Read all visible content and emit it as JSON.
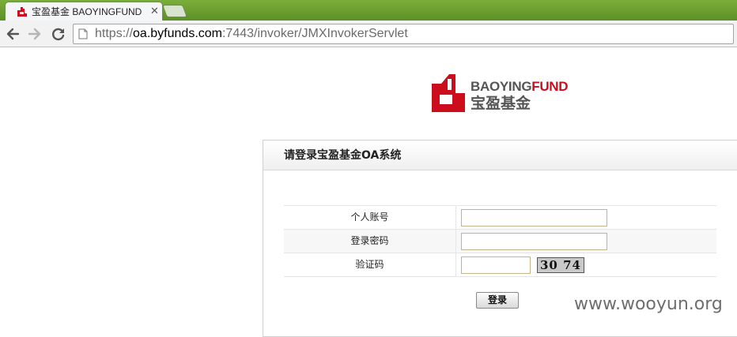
{
  "browser": {
    "tab": {
      "title": "宝盈基金 BAOYINGFUND",
      "close_glyph": "✕"
    },
    "address_bar": {
      "scheme": "https://",
      "host": "oa.byfunds.com",
      "rest": ":7443/invoker/JMXInvokerServlet"
    },
    "icons": {
      "back": "back-arrow-icon",
      "forward": "forward-arrow-icon",
      "reload": "reload-icon",
      "page": "page-icon",
      "favicon": "baoying-favicon"
    }
  },
  "logo": {
    "en_prefix": "BAOYING",
    "en_suffix": "FUND",
    "cn": "宝盈基金",
    "brand_red": "#cc0e1c",
    "brand_gray": "#555555"
  },
  "login": {
    "title": "请登录宝盈基金OA系统",
    "fields": {
      "account_label": "个人账号",
      "account_value": "",
      "password_label": "登录密码",
      "password_value": "",
      "captcha_label": "验证码",
      "captcha_value": ""
    },
    "captcha_text": "30 74",
    "submit_label": "登录"
  },
  "watermark": "www.wooyun.org"
}
